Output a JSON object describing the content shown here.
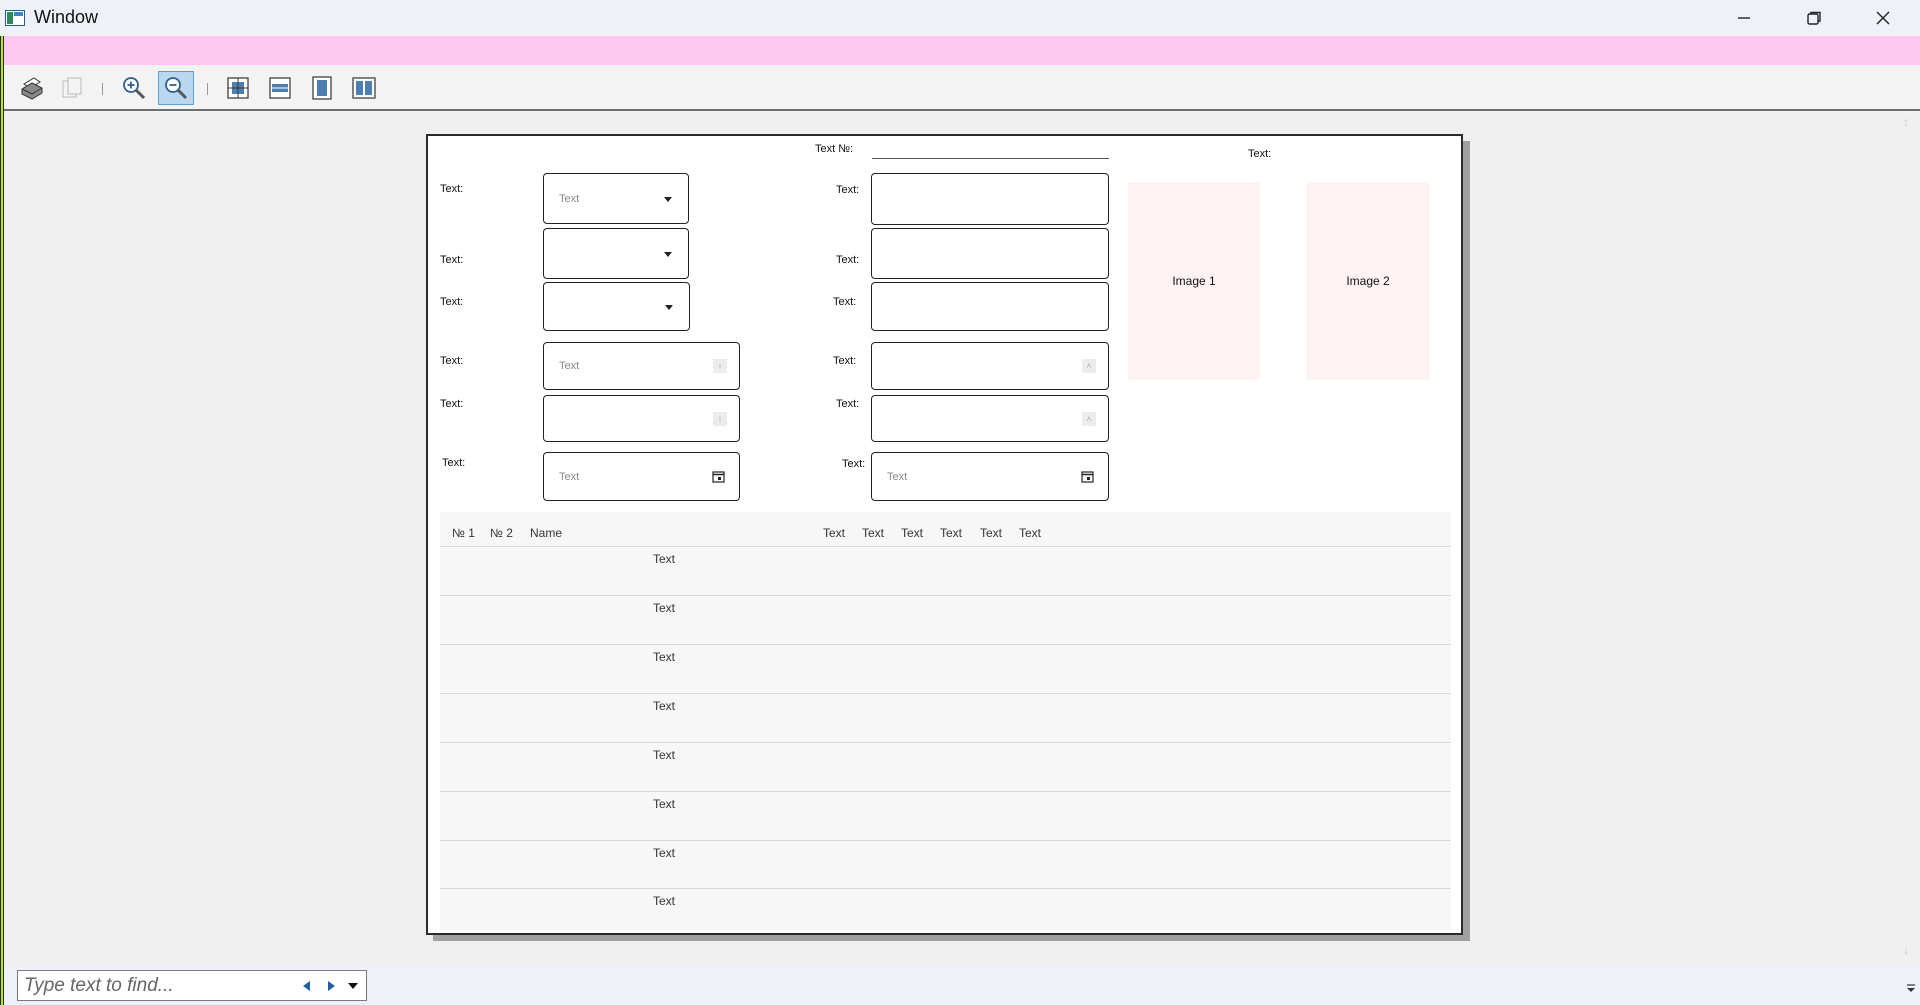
{
  "window": {
    "title": "Window",
    "accent_pink": "#fdc8f1",
    "minimize_icon": "minimize-icon",
    "restore_icon": "restore-icon",
    "close_icon": "close-icon"
  },
  "toolbar": {
    "buttons": [
      {
        "name": "print-button",
        "icon": "printer-icon"
      },
      {
        "name": "copy-button",
        "icon": "copy-icon"
      },
      {
        "name": "zoom-in-button",
        "icon": "zoom-in-icon"
      },
      {
        "name": "zoom-out-button",
        "icon": "zoom-out-icon",
        "active": true
      },
      {
        "name": "actual-size-button",
        "icon": "actual-size-icon"
      },
      {
        "name": "fit-width-button",
        "icon": "fit-width-icon"
      },
      {
        "name": "whole-page-button",
        "icon": "whole-page-icon"
      },
      {
        "name": "two-pages-button",
        "icon": "two-pages-icon"
      }
    ]
  },
  "document": {
    "header": {
      "number_label": "Text №:",
      "right_label": "Text:"
    },
    "left_fields": [
      {
        "label": "Text:",
        "type": "combobox",
        "value": "Text"
      },
      {
        "label": "Text:",
        "type": "combobox",
        "value": ""
      },
      {
        "label": "Text:",
        "type": "combobox",
        "value": ""
      },
      {
        "label": "Text:",
        "type": "numeric",
        "value": "Text"
      },
      {
        "label": "Text:",
        "type": "numeric",
        "value": ""
      },
      {
        "label": "Text:",
        "type": "date",
        "value": "Text"
      }
    ],
    "mid_fields": [
      {
        "label": "Text:",
        "type": "textbox",
        "value": ""
      },
      {
        "label": "Text:",
        "type": "textbox",
        "value": ""
      },
      {
        "label": "Text:",
        "type": "textbox",
        "value": ""
      },
      {
        "label": "Text:",
        "type": "numeric",
        "value": ""
      },
      {
        "label": "Text:",
        "type": "numeric",
        "value": ""
      },
      {
        "label": "Text:",
        "type": "date",
        "value": "Text"
      }
    ],
    "images": [
      "Image 1",
      "Image 2"
    ],
    "table": {
      "columns": [
        "№ 1",
        "№ 2",
        "Name",
        "Text",
        "Text",
        "Text",
        "Text",
        "Text",
        "Text"
      ],
      "rows": [
        "Text",
        "Text",
        "Text",
        "Text",
        "Text",
        "Text",
        "Text",
        "Text"
      ]
    }
  },
  "find": {
    "placeholder": "Type text to find...",
    "prev_icon": "triangle-left-icon",
    "next_icon": "triangle-right-icon",
    "options_icon": "dropdown-icon"
  }
}
